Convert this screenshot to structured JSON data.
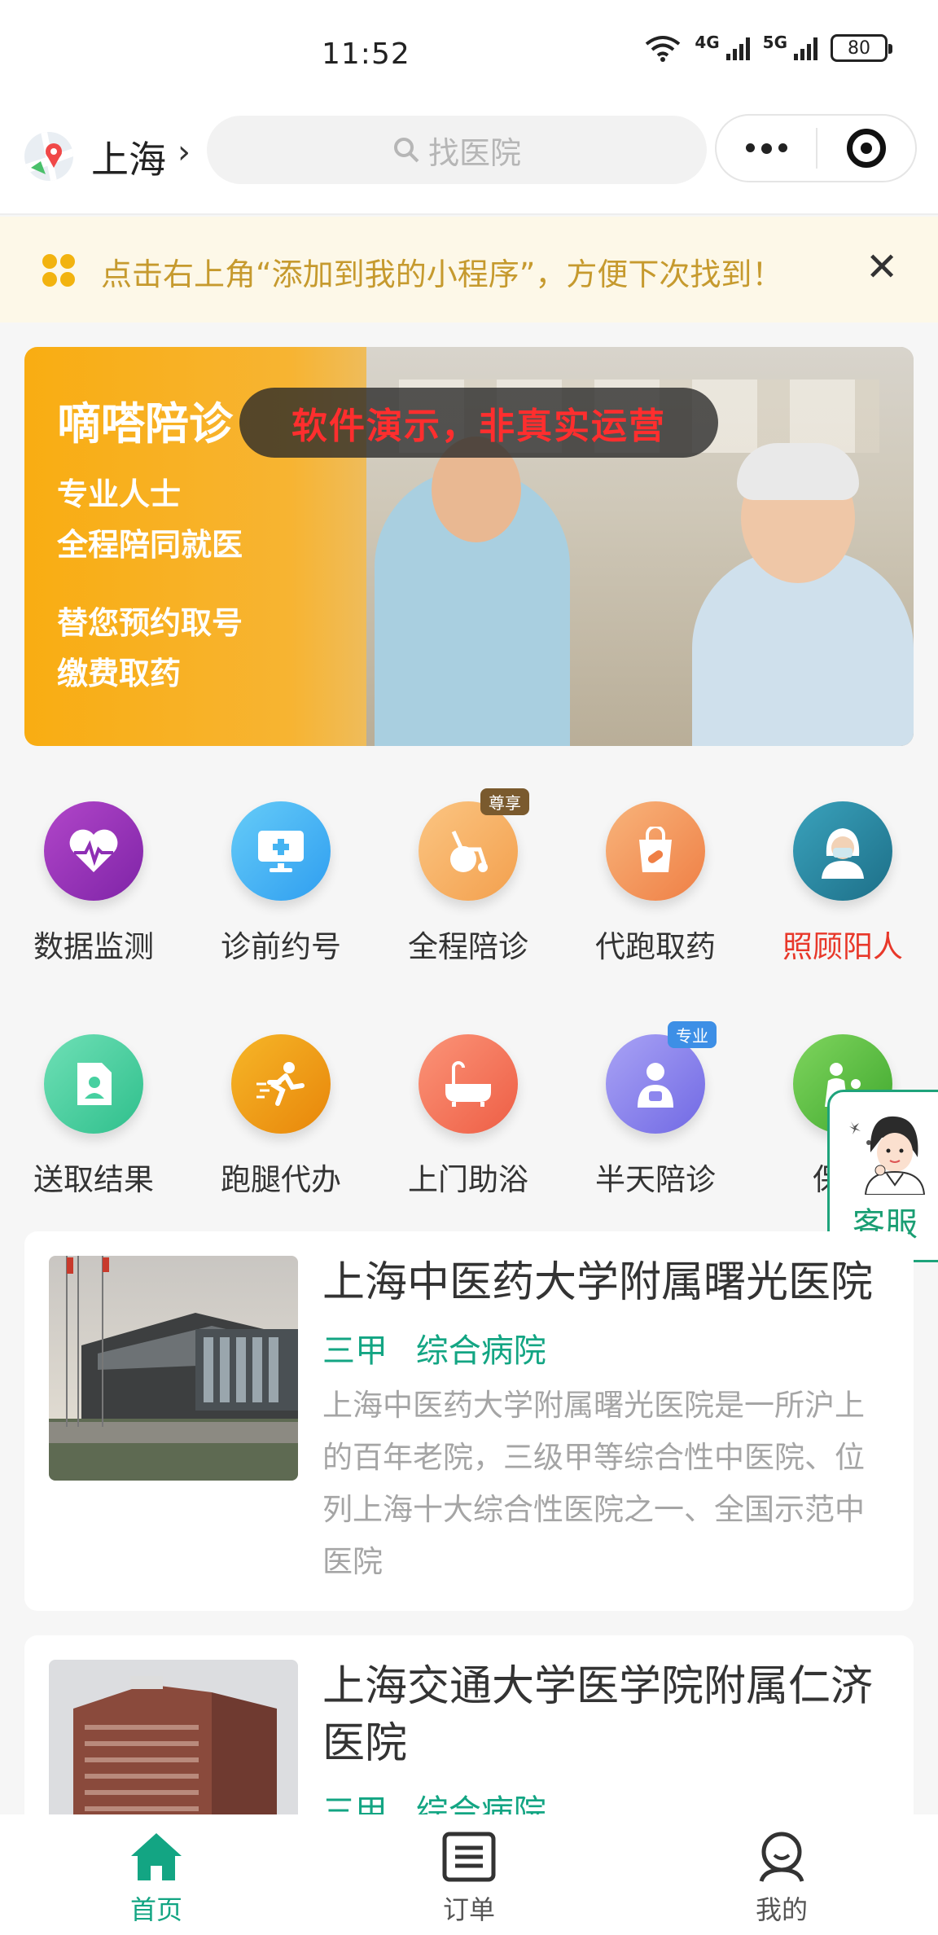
{
  "status_bar": {
    "time": "11:52",
    "network_4g": "4G",
    "network_5g": "5G",
    "battery": "80"
  },
  "nav": {
    "city": "上海",
    "search_placeholder": "找医院"
  },
  "tip": {
    "text": "点击右上角“添加到我的小程序”，方便下次找到！"
  },
  "banner": {
    "title": "嘀嗒陪诊",
    "lines": [
      "专业人士",
      "全程陪同就医",
      "替您预约取号",
      "缴费取药"
    ],
    "stamp": "软件演示，非真实运营"
  },
  "services": [
    {
      "label": "数据监测",
      "icon": "heartbeat-icon",
      "color": "#8e2fb4"
    },
    {
      "label": "诊前约号",
      "icon": "monitor-icon",
      "color": "#45b4f2"
    },
    {
      "label": "全程陪诊",
      "icon": "wheelchair-icon",
      "color": "#f6b067",
      "tag": "尊享"
    },
    {
      "label": "代跑取药",
      "icon": "medicine-bag-icon",
      "color": "#f39a5b"
    },
    {
      "label": "照顾阳人",
      "icon": "nurse-icon",
      "color": "#2b8aa4"
    },
    {
      "label": "送取结果",
      "icon": "report-icon",
      "color": "#46d0a0"
    },
    {
      "label": "跑腿代办",
      "icon": "runner-icon",
      "color": "#f0a20b"
    },
    {
      "label": "上门助浴",
      "icon": "bathtub-icon",
      "color": "#f57c62"
    },
    {
      "label": "半天陪诊",
      "icon": "patient-icon",
      "color": "#8d86ee",
      "tag": "专业"
    },
    {
      "label": "保姆",
      "icon": "caregiver-icon",
      "color": "#5cc242"
    }
  ],
  "customer_service": {
    "label": "客服"
  },
  "hospitals": [
    {
      "name": "上海中医药大学附属曙光医院",
      "level": "三甲",
      "type": "综合病院",
      "description": "上海中医药大学附属曙光医院是一所沪上的百年老院，三级甲等综合性中医院、位列上海十大综合性医院之一、全国示范中医院"
    },
    {
      "name": "上海交通大学医学院附属仁济医院",
      "level": "三甲",
      "type": "综合病院"
    }
  ],
  "tabbar": {
    "home": "首页",
    "orders": "订单",
    "mine": "我的"
  },
  "colors": {
    "brand_green": "#13a583",
    "tip_text": "#c69a2e",
    "stamp_red": "#ff2e2e"
  }
}
